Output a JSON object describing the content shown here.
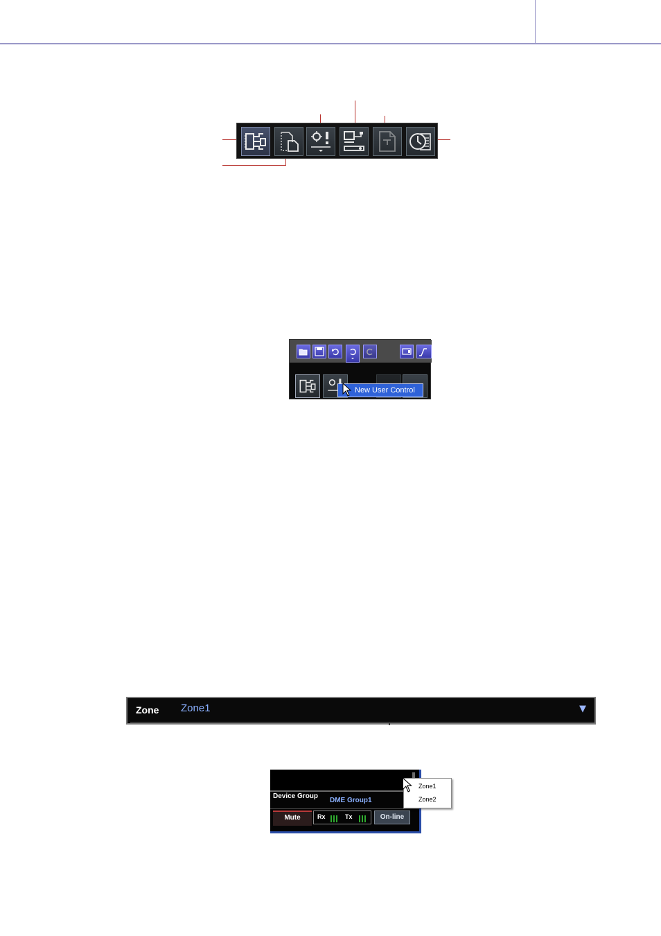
{
  "toolbar_main": {
    "buttons": [
      {
        "icon": "component-editor-icon",
        "state": "active"
      },
      {
        "icon": "user-module-sheet-icon",
        "state": "normal"
      },
      {
        "icon": "user-control-icon",
        "state": "normal"
      },
      {
        "icon": "device-config-icon",
        "state": "normal"
      },
      {
        "icon": "edit-page-icon",
        "state": "dim"
      },
      {
        "icon": "scheduler-icon",
        "state": "normal"
      }
    ],
    "callout_color": "#b8332e"
  },
  "menu_example": {
    "toolbar_icons": [
      "open-icon",
      "save-icon",
      "undo-icon",
      "undo-list-icon",
      "redo-icon",
      "monitor-icon",
      "level-meter-icon"
    ],
    "context_item": "New User Control"
  },
  "zone_bar": {
    "label": "Zone",
    "value": "Zone1",
    "dropdown_icon": "triangle-down-icon"
  },
  "device_group_panel": {
    "label": "Device Group",
    "value": "DME Group1",
    "mute": "Mute",
    "rx": "Rx",
    "tx": "Tx",
    "online": "On-line",
    "dropdown_options": [
      "Zone1",
      "Zone2"
    ]
  },
  "colors": {
    "rule": "#9a98c8",
    "zone_value": "#8ab0ff",
    "menu_highlight": "#2f62d8"
  }
}
